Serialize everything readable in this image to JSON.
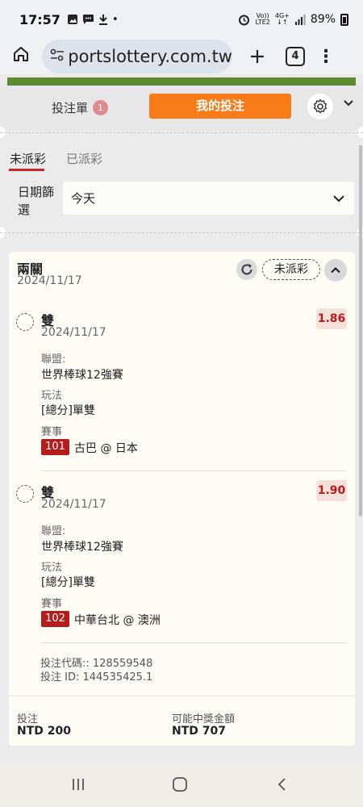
{
  "status_bar": {
    "time": "17:57",
    "battery": "89%",
    "volte": "Vo))",
    "lte": "LTE2",
    "net": "4G+"
  },
  "browser": {
    "url": "portslottery.com.tw",
    "tab_count": "4"
  },
  "site_header": {
    "betslip_label": "投注單",
    "betslip_count": "1",
    "my_bets_label": "我的投注"
  },
  "filter_tabs": {
    "unsettled": "未派彩",
    "settled": "已派彩"
  },
  "date_filter": {
    "label": "日期篩選",
    "value": "今天"
  },
  "bet": {
    "title": "兩關",
    "date": "2024/11/17",
    "status": "未派彩",
    "selections": [
      {
        "pick": "雙",
        "date": "2024/11/17",
        "odds": "1.86",
        "league_label": "聯盟:",
        "league": "世界棒球12強賽",
        "market_label": "玩法",
        "market": "[總分]單雙",
        "event_label": "賽事",
        "match_no": "101",
        "match": "古巴 @ 日本"
      },
      {
        "pick": "雙",
        "date": "2024/11/17",
        "odds": "1.90",
        "league_label": "聯盟:",
        "league": "世界棒球12強賽",
        "market_label": "玩法",
        "market": "[總分]單雙",
        "event_label": "賽事",
        "match_no": "102",
        "match": "中華台北 @ 澳洲"
      }
    ],
    "bet_code": "投注代碼:: 128559548",
    "bet_id": "投注 ID: 144535425.1",
    "stake_label": "投注",
    "stake": "NTD 200",
    "payout_label": "可能中獎金額",
    "payout": "NTD 707"
  },
  "icons": [
    "image-icon",
    "chat-icon",
    "download-icon",
    "alarm-icon",
    "signal-icon",
    "battery-icon",
    "home-icon",
    "tune-icon",
    "plus-icon",
    "tabs-icon",
    "more-icon",
    "gear-icon",
    "chevron-down-icon",
    "refresh-icon",
    "chevron-up-icon",
    "recent-apps-icon",
    "home-nav-icon",
    "back-icon"
  ]
}
